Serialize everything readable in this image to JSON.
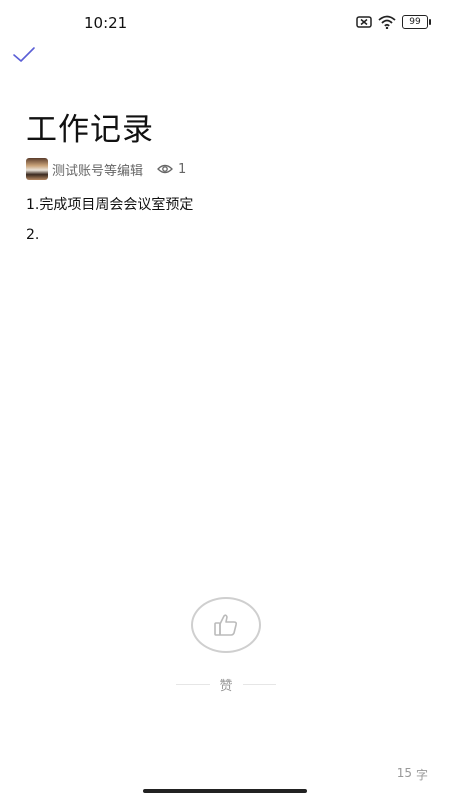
{
  "status": {
    "time": "10:21",
    "battery": "99"
  },
  "note": {
    "title": "工作记录",
    "editor": "测试账号等编辑",
    "views": "1",
    "lines": [
      "1.完成项目周会会议室预定",
      "2."
    ]
  },
  "like": {
    "label": "赞"
  },
  "footer": {
    "count": "15",
    "unit": "字"
  },
  "colors": {
    "accent": "#5b5fd6"
  }
}
